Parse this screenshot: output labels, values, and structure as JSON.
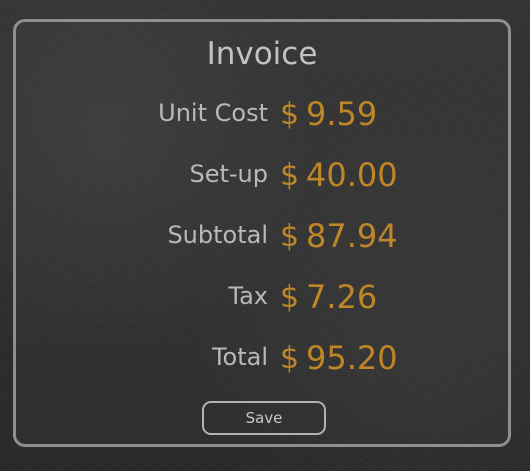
{
  "invoice": {
    "title": "Invoice",
    "currency_symbol": "$",
    "rows": [
      {
        "label": "Unit Cost",
        "amount": "9.59"
      },
      {
        "label": "Set-up",
        "amount": "40.00"
      },
      {
        "label": "Subtotal",
        "amount": "87.94"
      },
      {
        "label": "Tax",
        "amount": "7.26"
      },
      {
        "label": "Total",
        "amount": "95.20"
      }
    ],
    "save_label": "Save"
  },
  "colors": {
    "background": "#2f2f2f",
    "border": "#8f8f8f",
    "label_text": "#b9b9b9",
    "amount_text": "#bf8628"
  }
}
